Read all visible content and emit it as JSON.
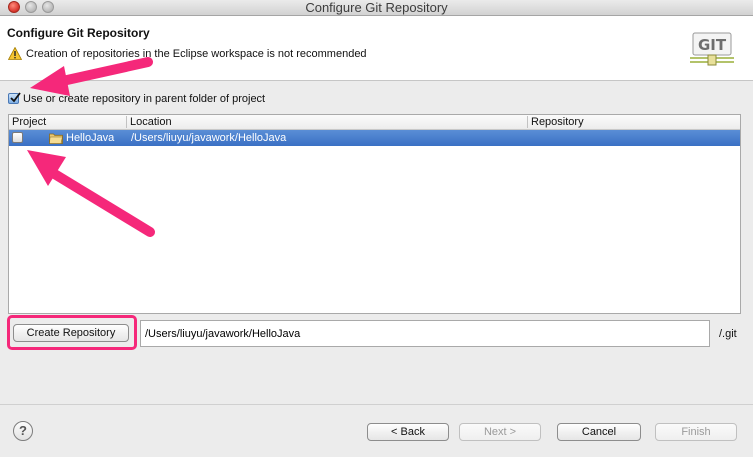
{
  "window": {
    "title": "Configure Git Repository"
  },
  "header": {
    "title": "Configure Git Repository",
    "warning": "Creation of repositories in the Eclipse workspace is not recommended",
    "logo_text": "GIT"
  },
  "option": {
    "label": "Use or create repository in parent folder of project",
    "checked": true
  },
  "table": {
    "columns": [
      "Project",
      "Location",
      "Repository"
    ],
    "rows": [
      {
        "project": "HelloJava",
        "location": "/Users/liuyu/javawork/HelloJava",
        "repository": "",
        "checked": false,
        "selected": true
      }
    ]
  },
  "create": {
    "button_label": "Create Repository",
    "path_value": "/Users/liuyu/javawork/HelloJava",
    "suffix": "/.git"
  },
  "footer": {
    "help": "?",
    "back": "< Back",
    "next": "Next >",
    "cancel": "Cancel",
    "finish": "Finish"
  },
  "colors": {
    "annotation": "#f5287a",
    "selection": "#3a70c4"
  }
}
